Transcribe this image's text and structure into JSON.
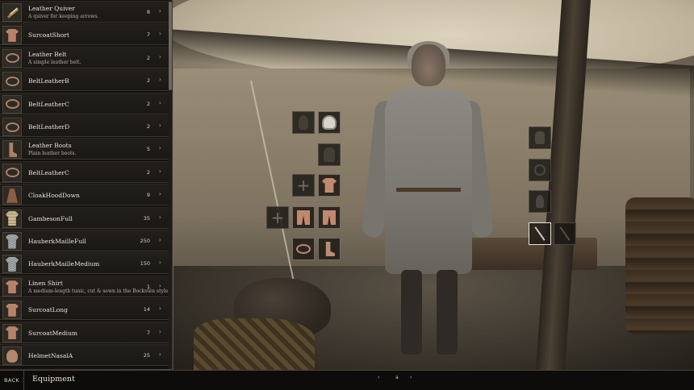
{
  "inventory": {
    "items": [
      {
        "name": "Leather Quiver",
        "description": "A quiver for keeping arrows.",
        "qty": "8",
        "icon": "quiver-icon"
      },
      {
        "name": "SurcoatShort",
        "description": "",
        "qty": "7",
        "icon": "shirt-icon"
      },
      {
        "name": "Leather Belt",
        "description": "A simple leather belt.",
        "qty": "2",
        "icon": "belt-icon"
      },
      {
        "name": "BeltLeatherB",
        "description": "",
        "qty": "2",
        "icon": "belt-icon"
      },
      {
        "name": "BeltLeatherC",
        "description": "",
        "qty": "2",
        "icon": "belt-icon"
      },
      {
        "name": "BeltLeatherD",
        "description": "",
        "qty": "2",
        "icon": "belt-icon"
      },
      {
        "name": "Leather Boots",
        "description": "Plain leather boots.",
        "qty": "5",
        "icon": "boot-icon"
      },
      {
        "name": "BeltLeatherC",
        "description": "",
        "qty": "2",
        "icon": "belt-icon"
      },
      {
        "name": "CloakHoodDown",
        "description": "",
        "qty": "9",
        "icon": "cloak-icon"
      },
      {
        "name": "GambesonFull",
        "description": "",
        "qty": "35",
        "icon": "gambeson-icon"
      },
      {
        "name": "HauberkMailleFull",
        "description": "",
        "qty": "250",
        "icon": "mail-icon"
      },
      {
        "name": "HauberkMailleMedium",
        "description": "",
        "qty": "150",
        "icon": "mail-icon"
      },
      {
        "name": "Linen Shirt",
        "description": "A medium-length tunic, cut & sewn in the Bockstén style.",
        "qty": "1",
        "icon": "shirt-icon"
      },
      {
        "name": "SurcoatLong",
        "description": "",
        "qty": "14",
        "icon": "shirt-icon"
      },
      {
        "name": "SurcoatMedium",
        "description": "",
        "qty": "7",
        "icon": "shirt-icon"
      },
      {
        "name": "HelmetNasalA",
        "description": "",
        "qty": "25",
        "icon": "helmet-icon"
      }
    ],
    "arrow": "›"
  },
  "slots": {
    "plus": "+"
  },
  "bottombar": {
    "back_label": "BACK",
    "title": "Equipment",
    "pager_left": "‹",
    "pager_page": "a",
    "pager_right": "›"
  }
}
